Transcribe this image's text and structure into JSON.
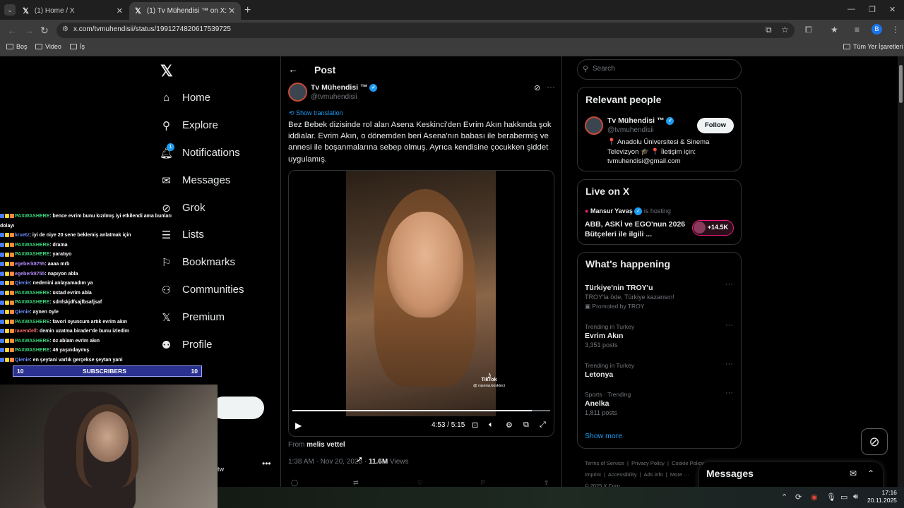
{
  "browser": {
    "tabs": [
      {
        "title": "(1) Home / X"
      },
      {
        "title": "(1) Tv Mühendisi ™ on X: \"Bez B"
      }
    ],
    "url": "x.com/tvmuhendisii/status/1991274820617539725",
    "profile_initial": "B",
    "bookmarks": [
      "Boş",
      "Video",
      "İş"
    ],
    "all_bookmarks": "Tüm Yer İşaretleri"
  },
  "nav": {
    "items": [
      {
        "label": "Home",
        "icon": "home-icon"
      },
      {
        "label": "Explore",
        "icon": "search-icon"
      },
      {
        "label": "Notifications",
        "icon": "bell-icon",
        "badge": "1"
      },
      {
        "label": "Messages",
        "icon": "envelope-icon"
      },
      {
        "label": "Grok",
        "icon": "grok-icon"
      },
      {
        "label": "Lists",
        "icon": "list-icon"
      },
      {
        "label": "Bookmarks",
        "icon": "bookmark-icon"
      },
      {
        "label": "Communities",
        "icon": "people-icon"
      },
      {
        "label": "Premium",
        "icon": "x-icon"
      },
      {
        "label": "Profile",
        "icon": "person-icon"
      }
    ]
  },
  "overlay": {
    "chat": [
      {
        "user": "PAXWASHERE",
        "msg": ": bence evrim bunu kızılmış iyi etkilendi ama bunları",
        "color": "#3ad27a"
      },
      {
        "user": "",
        "msg": "dolayı",
        "color": "#ffffff"
      },
      {
        "user": "kruetz",
        "msg": ": iyi de niye 20 sene beklemiş anlatmak için",
        "color": "#6a8cff"
      },
      {
        "user": "PAXWASHERE",
        "msg": ": drama",
        "color": "#3ad27a"
      },
      {
        "user": "PAXWASHERE",
        "msg": ": yaratıyo",
        "color": "#3ad27a"
      },
      {
        "user": "egeberk8755",
        "msg": ": aaaa mrb",
        "color": "#b58cff"
      },
      {
        "user": "egeberk8755",
        "msg": ": napıyon abla",
        "color": "#b58cff"
      },
      {
        "user": "Qienie",
        "msg": ": nedenini anlayamadım ya",
        "color": "#6a8cff"
      },
      {
        "user": "PAXWASHERE",
        "msg": ": üstad evrim abla",
        "color": "#3ad27a"
      },
      {
        "user": "PAXWASHERE",
        "msg": ": sdnfskjdfsajfbsafjsaf",
        "color": "#3ad27a"
      },
      {
        "user": "Qienie",
        "msg": ": aynen öyle",
        "color": "#6a8cff"
      },
      {
        "user": "PAXWASHERE",
        "msg": ": favori oyuncum artık evrim akın",
        "color": "#3ad27a"
      },
      {
        "user": "ravendell",
        "msg": ": demin uzatma birader'de bunu izledim",
        "color": "#ff6b6b"
      },
      {
        "user": "PAXWASHERE",
        "msg": ": öz ablam evrim akın",
        "color": "#3ad27a"
      },
      {
        "user": "PAXWASHERE",
        "msg": ": 46 yaşındaymış",
        "color": "#3ad27a"
      },
      {
        "user": "Qienie",
        "msg": ": en şeytani varlık gerçekse şeytan yani",
        "color": "#6a8cff"
      }
    ],
    "sub_left": "10",
    "sub_label": "SUBSCRIBERS",
    "sub_right": "10",
    "bottom_text": "tw"
  },
  "post": {
    "header": "Post",
    "author_name": "Tv Mühendisi ™",
    "author_handle": "@tvmuhendisii",
    "show_translation": "Show translation",
    "text": "Bez Bebek dizisinde rol alan Asena Keskinci'den Evrim Akın hakkında şok iddialar. Evrim Akın, o dönemden beri Asena'nın babası ile berabermiş ve annesi ile boşanmalarına sebep olmuş. Ayrıca kendisine çocukken şiddet uygulamış.",
    "video": {
      "time": "4:53 / 5:15",
      "progress": 0.93,
      "tiktok_label": "TikTok",
      "tiktok_handle": "@ rasena.keskinci"
    },
    "from_prefix": "From",
    "from_name": "melis vettel",
    "timestamp": "1:38 AM · Nov 20, 2025 · ",
    "views_count": "11.6M",
    "views_label": "Views"
  },
  "sidebar": {
    "search_placeholder": "Search",
    "relevant_title": "Relevant people",
    "rp_name": "Tv Mühendisi ™",
    "rp_handle": "@tvmuhendisii",
    "follow_label": "Follow",
    "rp_bio": "📍 Anadolu Üniversitesi & Sinema Televizyon 🎓 📍 İletişim için: tvmuhendisi@gmail.com",
    "live_title": "Live on X",
    "live_host_name": "Mansur Yavaş",
    "live_host_suffix": "is hosting",
    "live_desc": "ABB, ASKİ ve EGO'nun 2026 Bütçeleri ile ilgili ...",
    "live_count": "+14.5K",
    "happening_title": "What's happening",
    "trends": [
      {
        "ctx": "",
        "name": "Türkiye'nin TROY'u",
        "sub": "TROY'la öde, Türkiye kazansın!",
        "promo": "Promoted by TROY"
      },
      {
        "ctx": "Trending in Turkey",
        "name": "Evrim Akın",
        "sub": "3,351 posts"
      },
      {
        "ctx": "Trending in Turkey",
        "name": "Letonya",
        "sub": ""
      },
      {
        "ctx": "Sports · Trending",
        "name": "Anelka",
        "sub": "1,811 posts"
      }
    ],
    "show_more": "Show more",
    "footer": [
      "Terms of Service",
      "Privacy Policy",
      "Cookie Policy",
      "Imprint",
      "Accessibility",
      "Ads info",
      "More ···",
      "© 2025 X Corp."
    ]
  },
  "messages_dock": {
    "title": "Messages"
  },
  "taskbar": {
    "time": "17:16",
    "date": "20.11.2025"
  }
}
